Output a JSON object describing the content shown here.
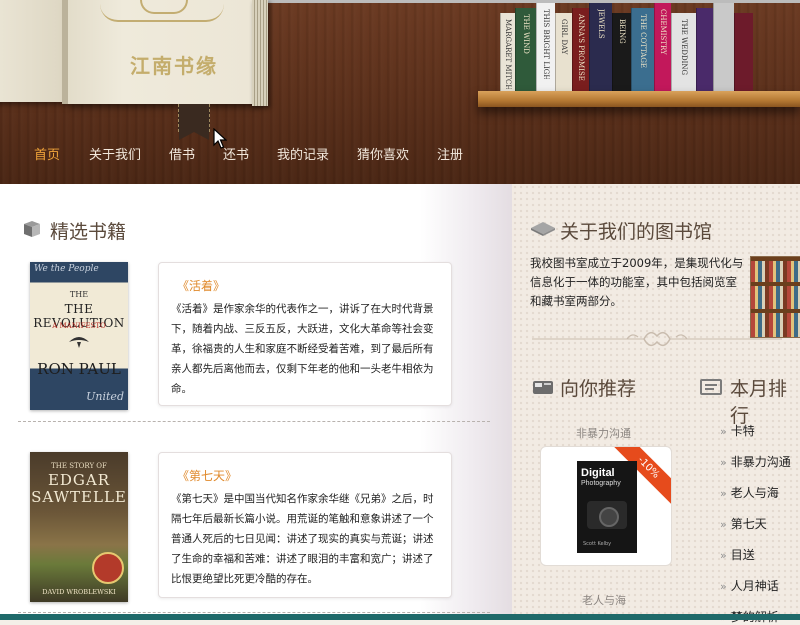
{
  "header": {
    "logo_text": "江南书缘",
    "nav": [
      {
        "label": "首页",
        "active": true
      },
      {
        "label": "关于我们",
        "active": false
      },
      {
        "label": "借书",
        "active": false
      },
      {
        "label": "还书",
        "active": false
      },
      {
        "label": "我的记录",
        "active": false
      },
      {
        "label": "猜你喜欢",
        "active": false
      },
      {
        "label": "注册",
        "active": false
      }
    ],
    "shelf_spines": [
      "MARGARET MITCHELL",
      "THE WIND",
      "THIS BRIGHT LIGHT",
      "GIRL DAY",
      "ANNA'S PROMISE",
      "JEWELS",
      "BEING",
      "THE COTTAGE",
      "CHEMISTRY",
      "THE WEDDING"
    ]
  },
  "featured": {
    "title": "精选书籍",
    "books": [
      {
        "cover_top": "We the People",
        "cover_title": "THE REVOLUTION",
        "cover_subtitle": "A MANIFESTO",
        "cover_author": "RON PAUL",
        "cover_bottom": "United",
        "title": "《活着》",
        "desc": "《活着》是作家余华的代表作之一，讲诉了在大时代背景下，随着内战、三反五反，大跃进，文化大革命等社会变革，徐福贵的人生和家庭不断经受着苦难，到了最后所有亲人都先后离他而去，仅剩下年老的他和一头老牛相依为命。"
      },
      {
        "cover_top": "THE STORY OF",
        "cover_title": "EDGAR SAWTELLE",
        "cover_author": "DAVID WROBLEWSKI",
        "title": "《第七天》",
        "desc": "《第七天》是中国当代知名作家余华继《兄弟》之后，时隔七年后最新长篇小说。用荒诞的笔触和意象讲述了一个普通人死后的七日见闻：讲述了现实的真实与荒诞；讲述了生命的幸福和苦难：讲述了眼泪的丰富和宽广；讲述了比恨更绝望比死更冷酷的存在。"
      }
    ]
  },
  "about": {
    "title": "关于我们的图书馆",
    "text": "我校图书室成立于2009年，是集现代化与信息化于一体的功能室，其中包括阅览室和藏书室两部分。"
  },
  "recommend": {
    "title": "向你推荐",
    "items": [
      {
        "name": "非暴力沟通",
        "badge": "-10%",
        "cover_title": "Digital Photography",
        "cover_author": "Scott Kelby"
      },
      {
        "name": "老人与海"
      }
    ]
  },
  "ranking": {
    "title": "本月排行",
    "items": [
      "卡特",
      "非暴力沟通",
      "老人与海",
      "第七天",
      "目送",
      "人月神话",
      "梦的解析"
    ]
  },
  "colors": {
    "accent": "#f0a43a",
    "card_title": "#e08a2c",
    "badge": "#e64b1c",
    "footer": "#1f6a6a"
  }
}
